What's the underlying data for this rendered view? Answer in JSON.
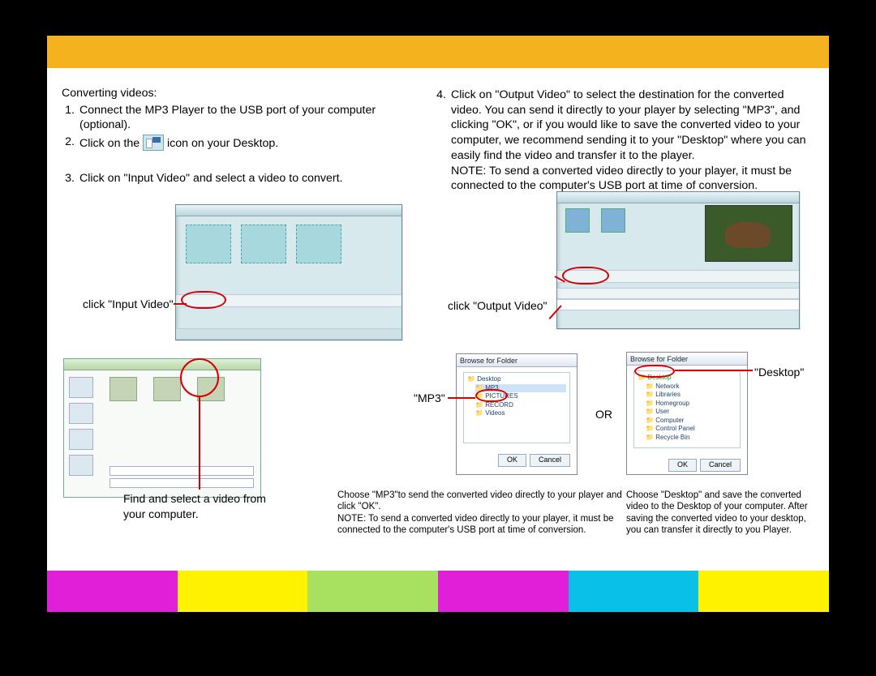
{
  "heading": "Converting videos:",
  "steps_left": [
    "Connect the MP3 Player to the USB port of your computer (optional).",
    "Click on the [ICON] icon on your Desktop.",
    "Click on \"Input Video\" and select a video to convert."
  ],
  "step_right": "Click on \"Output Video\" to select the destination for the converted video.  You can send it directly to your player by selecting \"MP3\", and clicking \"OK\", or if you would like to save the converted video to your computer, we recommend sending it to your \"Desktop\" where you can easily find the video and transfer it to the player.",
  "step_right_note": "NOTE: To send a converted video directly to your player, it must be connected to the computer's USB port at time of conversion.",
  "callouts": {
    "input_video": "click \"Input Video\"",
    "find_select": "Find and select  a video from  your computer.",
    "output_video": "click \"Output Video\"",
    "mp3": "\"MP3\"",
    "or": "OR",
    "desktop": "\"Desktop\""
  },
  "captions": {
    "mp3": "Choose \"MP3\"to send the converted video directly to your player and click \"OK\".\nNOTE: To send a converted video directly to your player, it must be connected to the computer's USB port at time of conversion.",
    "desktop": "Choose  \"Desktop\"    and save  the converted video to the Desktop  of your computer.  After saving  the converted  video to your desktop, you can transfer  it directly to you Player."
  },
  "footer_colors": [
    "#e11fd8",
    "#fff200",
    "#a8e05f",
    "#e11fd8",
    "#09c1e8",
    "#fff200"
  ]
}
